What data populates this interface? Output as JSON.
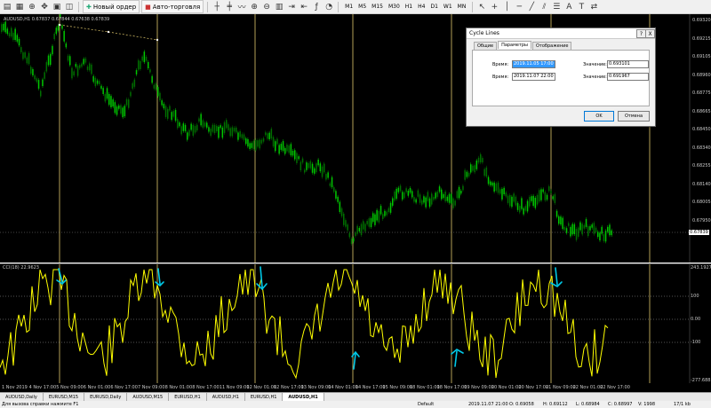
{
  "toolbar": {
    "new_order": "Новый ордер",
    "auto_trading": "Авто-торговля",
    "timeframes": [
      "M1",
      "M5",
      "M15",
      "M30",
      "H1",
      "H4",
      "D1",
      "W1",
      "MN"
    ]
  },
  "chart": {
    "title": "AUDUSD,H1  0.67837 0.67844 0.67638 0.67839",
    "price_labels": [
      "0.69320",
      "0.69215",
      "0.69105",
      "0.68960",
      "0.68775",
      "0.68665",
      "0.68450",
      "0.68340",
      "0.68255",
      "0.68140",
      "0.68005",
      "0.67950",
      "0.67839"
    ],
    "current_price": "0.67839"
  },
  "indicator": {
    "title": "CCI(18) 22.9623",
    "labels": [
      "243.1927",
      "100",
      "0.00",
      "-100",
      "-277.6883"
    ]
  },
  "time_axis": [
    "1 Nov 2019",
    "4 Nov 17:00",
    "5 Nov 09:00",
    "6 Nov 01:00",
    "6 Nov 17:00",
    "7 Nov 09:00",
    "8 Nov 01:00",
    "8 Nov 17:00",
    "11 Nov 09:00",
    "12 Nov 01:00",
    "12 Nov 17:00",
    "13 Nov 09:00",
    "14 Nov 01:00",
    "14 Nov 17:00",
    "15 Nov 09:00",
    "18 Nov 01:00",
    "18 Nov 17:00",
    "19 Nov 09:00",
    "20 Nov 01:00",
    "20 Nov 17:00",
    "21 Nov 09:00",
    "22 Nov 01:00",
    "22 Nov 17:00"
  ],
  "tabs": [
    "AUDUSD,Daily",
    "EURUSD,M15",
    "EURUSD,Daily",
    "AUDUSD,M15",
    "EURUSD,H1",
    "AUDUSD,H1",
    "EURUSD,H1",
    "AUDUSD,H1"
  ],
  "active_tab": 7,
  "status": {
    "hint": "Для вызова справки нажмите F1",
    "profile": "Default",
    "datetime": "2019.11.07 21:00",
    "o": "O: 0.69058",
    "h": "H: 0.69112",
    "l": "L: 0.68984",
    "c": "C: 0.68997",
    "v": "V: 1998",
    "traffic": "17/1 kb"
  },
  "dialog": {
    "title": "Cycle Lines",
    "help": "?",
    "close": "X",
    "tabs": [
      "Общие",
      "Параметры",
      "Отображение"
    ],
    "active_tab": 1,
    "time_label": "Время:",
    "value_label": "Значение:",
    "time1": "2019.11.05 17:00",
    "value1": "0.693101",
    "time2": "2019.11.07 22:00",
    "value2": "0.691967",
    "ok": "OK",
    "cancel": "Отмена"
  },
  "colors": {
    "bullish": "#00c800",
    "bearish": "#007000",
    "cycle_lines": "#e0c86c",
    "cci": "#ffff00",
    "annotation": "#00c8e6"
  }
}
